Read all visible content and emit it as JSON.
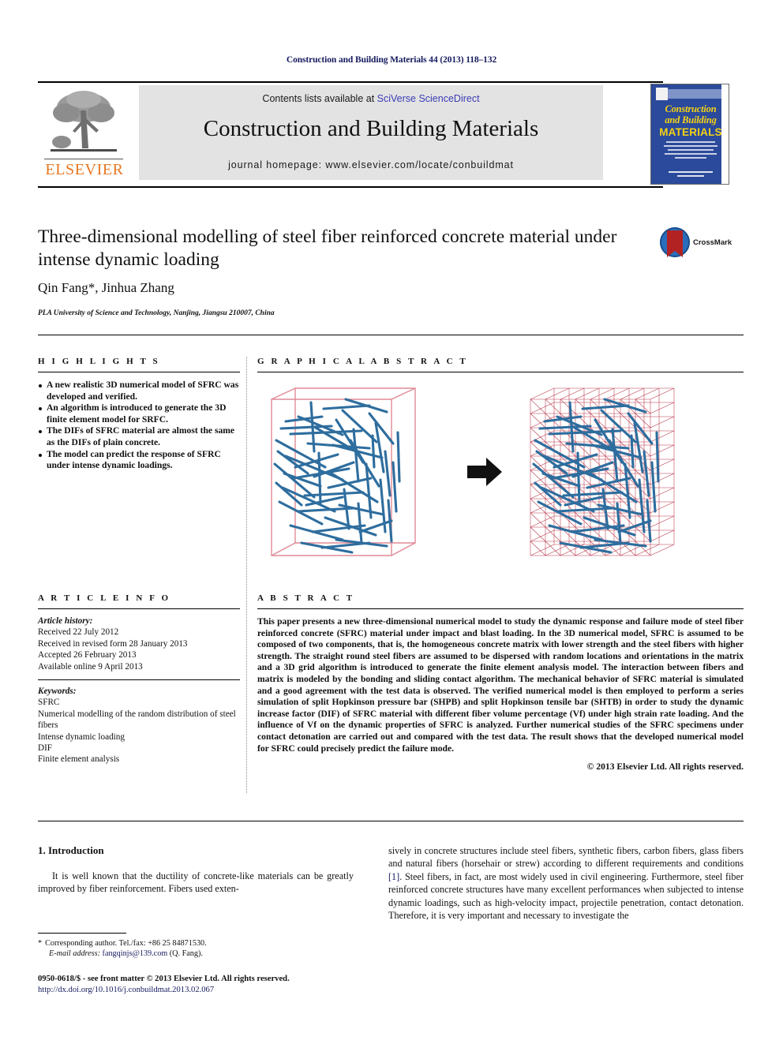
{
  "running_head": "Construction and Building Materials 44 (2013) 118–132",
  "masthead": {
    "publisher": "ELSEVIER",
    "contents_prefix": "Contents lists available at ",
    "contents_link": "SciVerse ScienceDirect",
    "journal_title": "Construction and Building Materials",
    "homepage": "journal homepage: www.elsevier.com/locate/conbuildmat",
    "cover": {
      "line1": "Construction",
      "line2": "and Building",
      "line3": "MATERIALS"
    }
  },
  "article": {
    "title": "Three-dimensional modelling of steel fiber reinforced concrete material under intense dynamic loading",
    "authors": "Qin Fang*, Jinhua Zhang",
    "affiliation": "PLA University of Science and Technology, Nanjing, Jiangsu 210007, China",
    "crossmark_label": "CrossMark"
  },
  "highlights": {
    "heading": "H I G H L I G H T S",
    "items": [
      "A new realistic 3D numerical model of SFRC was developed and verified.",
      "An algorithm is introduced to generate the 3D finite element model for SRFC.",
      "The DIFs of SFRC material are almost the same as the DIFs of plain concrete.",
      "The model can predict the response of SFRC under intense dynamic loadings."
    ]
  },
  "graphical_abstract": {
    "heading": "G R A P H I C A L   A B S T R A C T",
    "left_caption": "",
    "right_caption": "",
    "arrow": "right-arrow",
    "fiber_color": "#2e6d9e",
    "box_color": "#e08a96",
    "mesh_color": "#b5293f"
  },
  "article_info": {
    "heading": "A R T I C L E   I N F O",
    "history_label": "Article history:",
    "history": [
      "Received 22 July 2012",
      "Received in revised form 28 January 2013",
      "Accepted 26 February 2013",
      "Available online 9 April 2013"
    ],
    "keywords_label": "Keywords:",
    "keywords": [
      "SFRC",
      "Numerical modelling of the random distribution of steel fibers",
      "Intense dynamic loading",
      "DIF",
      "Finite element analysis"
    ]
  },
  "abstract": {
    "heading": "A B S T R A C T",
    "text": "This paper presents a new three-dimensional numerical model to study the dynamic response and failure mode of steel fiber reinforced concrete (SFRC) material under impact and blast loading. In the 3D numerical model, SFRC is assumed to be composed of two components, that is, the homogeneous concrete matrix with lower strength and the steel fibers with higher strength. The straight round steel fibers are assumed to be dispersed with random locations and orientations in the matrix and a 3D grid algorithm is introduced to generate the finite element analysis model. The interaction between fibers and matrix is modeled by the bonding and sliding contact algorithm. The mechanical behavior of SFRC material is simulated and a good agreement with the test data is observed. The verified numerical model is then employed to perform a series simulation of split Hopkinson pressure bar (SHPB) and split Hopkinson tensile bar (SHTB) in order to study the dynamic increase factor (DIF) of SFRC material with different fiber volume percentage (Vf) under high strain rate loading. And the influence of Vf on the dynamic properties of SFRC is analyzed. Further numerical studies of the SFRC specimens under contact detonation are carried out and compared with the test data. The result shows that the developed numerical model for SFRC could precisely predict the failure mode.",
    "copyright": "© 2013 Elsevier Ltd. All rights reserved."
  },
  "body": {
    "section_heading": "1. Introduction",
    "left_paragraph": "It is well known that the ductility of concrete-like materials can be greatly improved by fiber reinforcement. Fibers used exten-",
    "right_paragraph_part1": "sively in concrete structures include steel fibers, synthetic fibers, carbon fibers, glass fibers and natural fibers (horsehair or strew) according to different requirements and conditions ",
    "right_reference": "[1]",
    "right_paragraph_part2": ". Steel fibers, in fact, are most widely used in civil engineering. Furthermore, steel fiber reinforced concrete structures have many excellent performances when subjected to intense dynamic loadings, such as high-velocity impact, projectile penetration, contact detonation. Therefore, it is very important and necessary to investigate the"
  },
  "footnote": {
    "star": "*",
    "corresponding": "Corresponding author. Tel./fax: +86 25 84871530.",
    "email_label": "E-mail address:",
    "email": "fangqinjs@139.com",
    "email_suffix": "(Q. Fang)."
  },
  "footer": {
    "issn_line": "0950-0618/$ - see front matter © 2013 Elsevier Ltd. All rights reserved.",
    "doi": "http://dx.doi.org/10.1016/j.conbuildmat.2013.02.067"
  }
}
